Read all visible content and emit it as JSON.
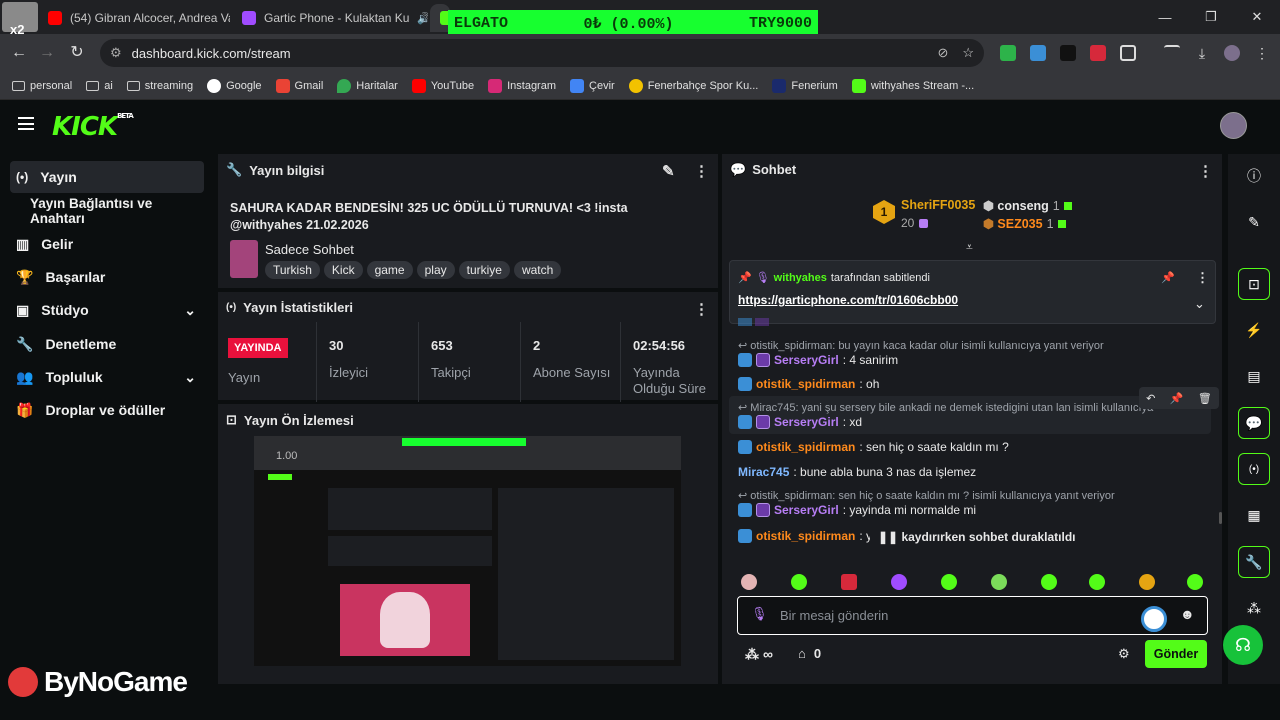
{
  "browser": {
    "tabs": [
      {
        "label": "(54) Gibran Alcocer, Andrea Van",
        "favicon_color": "#ff0000"
      },
      {
        "label": "Gartic Phone - Kulaktan Ku",
        "favicon_color": "#a04cff"
      },
      {
        "label": "",
        "favicon_color": "#53fc18"
      }
    ],
    "url": "dashboard.kick.com/stream",
    "bookmarks": [
      "personal",
      "ai",
      "streaming",
      "Google",
      "Gmail",
      "Haritalar",
      "YouTube",
      "Instagram",
      "Çevir",
      "Fenerbahçe Spor Ku...",
      "Fenerium",
      "withyahes Stream -..."
    ],
    "avatar_badge": "x2"
  },
  "overlay": {
    "left": "ELGATO",
    "center": "0₺ (0.00%)",
    "right": "TRY9000"
  },
  "app": {
    "logo": "KICK",
    "beta": "BETA"
  },
  "sidebar": {
    "items": [
      {
        "label": "Yayın",
        "icon": "broadcast-icon"
      },
      {
        "label": "Yayın Bağlantısı ve Anahtarı",
        "icon": ""
      },
      {
        "label": "Gelir",
        "icon": "chart-icon"
      },
      {
        "label": "Başarılar",
        "icon": "trophy-icon"
      },
      {
        "label": "Stüdyo",
        "icon": "studio-icon"
      },
      {
        "label": "Denetleme",
        "icon": "wrench-icon"
      },
      {
        "label": "Topluluk",
        "icon": "people-icon"
      },
      {
        "label": "Droplar ve ödüller",
        "icon": "gift-icon"
      }
    ]
  },
  "stream_info": {
    "title": "Yayın bilgisi",
    "stream_title": "SAHURA KADAR BENDESİN! 325 UC ÖDÜLLÜ TURNUVA! <3 !insta @withyahes 21.02.2026",
    "category": "Sadece Sohbet",
    "tags": [
      "Turkish",
      "Kick",
      "game",
      "play",
      "turkiye",
      "watch"
    ]
  },
  "stats": {
    "title": "Yayın İstatistikleri",
    "live_badge": "YAYINDA",
    "live_label": "Yayın",
    "items": [
      {
        "value": "30",
        "label": "İzleyici"
      },
      {
        "value": "653",
        "label": "Takipçi"
      },
      {
        "value": "2",
        "label": "Abone Sayısı"
      },
      {
        "value": "02:54:56",
        "label": "Yayında Olduğu Süre"
      }
    ]
  },
  "preview": {
    "title": "Yayın Ön İzlemesi",
    "zoom": "1.00"
  },
  "chat": {
    "title": "Sohbet",
    "leaderboard": [
      {
        "rank": "1",
        "name": "SheriFF0035",
        "count": "20"
      },
      {
        "name": "conseng",
        "count": "1"
      },
      {
        "name": "SEZ035",
        "count": "1"
      }
    ],
    "pinned": {
      "user": "withyahes",
      "suffix": "tarafından sabitlendi",
      "link": "https://garticphone.com/tr/01606cbb00"
    },
    "messages": [
      {
        "type": "reply",
        "text": "otistik_spidirman: bu yayın kaca kadar olur isimli kullanıcıya yanıt veriyor"
      },
      {
        "type": "msg",
        "user": "SerseryGirl",
        "color": "#b77ef5",
        "text": ": 4 sanirim"
      },
      {
        "type": "msg",
        "user": "otistik_spidirman",
        "color": "#ff8a1c",
        "text": ": oh"
      },
      {
        "type": "reply",
        "text": "Mirac745: yani şu sersery bile ankadi ne demek istedigini utan lan isimli kullanıcıya"
      },
      {
        "type": "msg",
        "user": "SerseryGirl",
        "color": "#b77ef5",
        "text": ": xd"
      },
      {
        "type": "msg",
        "user": "otistik_spidirman",
        "color": "#ff8a1c",
        "text": ": sen hiç o saate kaldın mı ?"
      },
      {
        "type": "msg",
        "user": "Mirac745",
        "color": "#7fb8ff",
        "text": ": bune abla buna 3 nas da işlemez"
      },
      {
        "type": "reply",
        "text": "otistik_spidirman: sen hiç o saate kaldın mı ? isimli kullanıcıya yanıt veriyor"
      },
      {
        "type": "msg",
        "user": "SerseryGirl",
        "color": "#b77ef5",
        "text": ": yayinda mi normalde mi"
      },
      {
        "type": "msg",
        "user": "otistik_spidirman",
        "color": "#ff8a1c",
        "text": ": yay"
      }
    ],
    "paused": "kaydırırken sohbet duraklatıldı",
    "input_placeholder": "Bir mesaj gönderin",
    "points": "∞",
    "store_count": "0",
    "send": "Gönder"
  },
  "watermark": "ByNoGame",
  "colors": {
    "brand": "#53fc18",
    "live": "#e9113c"
  }
}
